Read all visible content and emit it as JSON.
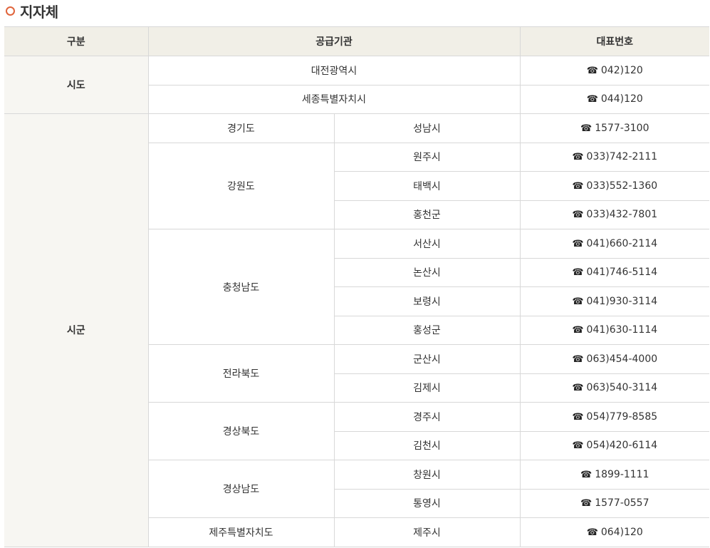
{
  "section": {
    "title": "지자체"
  },
  "table": {
    "headers": [
      "구분",
      "공급기관",
      "대표번호"
    ],
    "sido": {
      "label": "시도",
      "rows": [
        {
          "org": "대전광역시",
          "phone": "042)120"
        },
        {
          "org": "세종특별자치시",
          "phone": "044)120"
        }
      ]
    },
    "sigun": {
      "label": "시군",
      "provinces": [
        {
          "name": "경기도",
          "cities": [
            {
              "city": "성남시",
              "phone": "1577-3100"
            }
          ]
        },
        {
          "name": "강원도",
          "cities": [
            {
              "city": "원주시",
              "phone": "033)742-2111"
            },
            {
              "city": "태백시",
              "phone": "033)552-1360"
            },
            {
              "city": "홍천군",
              "phone": "033)432-7801"
            }
          ]
        },
        {
          "name": "충청남도",
          "cities": [
            {
              "city": "서산시",
              "phone": "041)660-2114"
            },
            {
              "city": "논산시",
              "phone": "041)746-5114"
            },
            {
              "city": "보령시",
              "phone": "041)930-3114"
            },
            {
              "city": "홍성군",
              "phone": "041)630-1114"
            }
          ]
        },
        {
          "name": "전라북도",
          "cities": [
            {
              "city": "군산시",
              "phone": "063)454-4000"
            },
            {
              "city": "김제시",
              "phone": "063)540-3114"
            }
          ]
        },
        {
          "name": "경상북도",
          "cities": [
            {
              "city": "경주시",
              "phone": "054)779-8585"
            },
            {
              "city": "김천시",
              "phone": "054)420-6114"
            }
          ]
        },
        {
          "name": "경상남도",
          "cities": [
            {
              "city": "창원시",
              "phone": "1899-1111"
            },
            {
              "city": "통영시",
              "phone": "1577-0557"
            }
          ]
        },
        {
          "name": "제주특별자치도",
          "cities": [
            {
              "city": "제주시",
              "phone": "064)120"
            }
          ]
        }
      ]
    },
    "phone_icon": "telephone-icon"
  }
}
